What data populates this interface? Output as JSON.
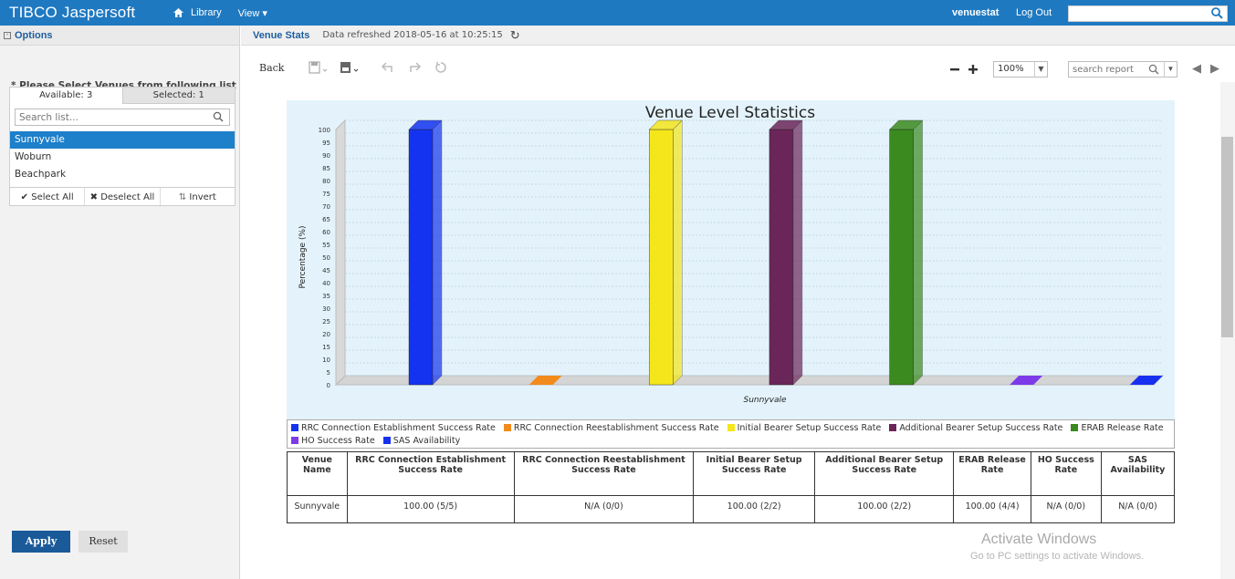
{
  "topbar": {
    "logo": "TIBCO Jaspersoft",
    "library": "Library",
    "view": "View ▾",
    "user": "venuestat",
    "logout": "Log Out",
    "search_value": ""
  },
  "options": {
    "title": "Options",
    "prompt": "* Please Select Venues from following list",
    "tab_available": "Available: 3",
    "tab_selected": "Selected: 1",
    "search_placeholder": "Search list...",
    "items": [
      "Sunnyvale",
      "Woburn",
      "Beachpark"
    ],
    "select_all": "✔ Select All",
    "deselect_all": "✖ Deselect All",
    "invert": "Invert",
    "apply": "Apply",
    "reset": "Reset"
  },
  "report": {
    "title": "Venue Stats",
    "refreshed": "Data refreshed 2018-05-16 at 10:25:15",
    "back": "Back",
    "zoom": "100%",
    "search_placeholder": "search report"
  },
  "chart_data": {
    "type": "bar",
    "title": "Venue Level Statistics",
    "ylabel": "Percentage (%)",
    "xlabel": "",
    "categories": [
      "Sunnyvale"
    ],
    "ylim": [
      0,
      100
    ],
    "yticks": [
      0,
      5,
      10,
      15,
      20,
      25,
      30,
      35,
      40,
      45,
      50,
      55,
      60,
      65,
      70,
      75,
      80,
      85,
      90,
      95,
      100
    ],
    "series": [
      {
        "name": "RRC Connection Establishment Success Rate",
        "values": [
          100
        ],
        "color": "#1433f0"
      },
      {
        "name": "RRC Connection Reestablishment Success Rate",
        "values": [
          0
        ],
        "color": "#f28b1c"
      },
      {
        "name": "Initial Bearer Setup Success Rate",
        "values": [
          100
        ],
        "color": "#f5e61c"
      },
      {
        "name": "Additional Bearer Setup Success Rate",
        "values": [
          100
        ],
        "color": "#6b2659"
      },
      {
        "name": "ERAB Release Rate",
        "values": [
          100
        ],
        "color": "#3a8a1f"
      },
      {
        "name": "HO Success Rate",
        "values": [
          0
        ],
        "color": "#7c3ae8"
      },
      {
        "name": "SAS Availability",
        "values": [
          0
        ],
        "color": "#1730f0"
      }
    ],
    "legend": "bottom"
  },
  "table": {
    "headers": [
      "Venue Name",
      "RRC Connection Establishment Success Rate",
      "RRC Connection Reestablishment Success Rate",
      "Initial Bearer Setup Success Rate",
      "Additional Bearer Setup Success Rate",
      "ERAB Release Rate",
      "HO Success Rate",
      "SAS Availability"
    ],
    "rows": [
      [
        "Sunnyvale",
        "100.00 (5/5)",
        "N/A (0/0)",
        "100.00 (2/2)",
        "100.00 (2/2)",
        "100.00 (4/4)",
        "N/A (0/0)",
        "N/A (0/0)"
      ]
    ]
  },
  "watermark": {
    "line1": "Activate Windows",
    "line2": "Go to PC settings to activate Windows."
  }
}
